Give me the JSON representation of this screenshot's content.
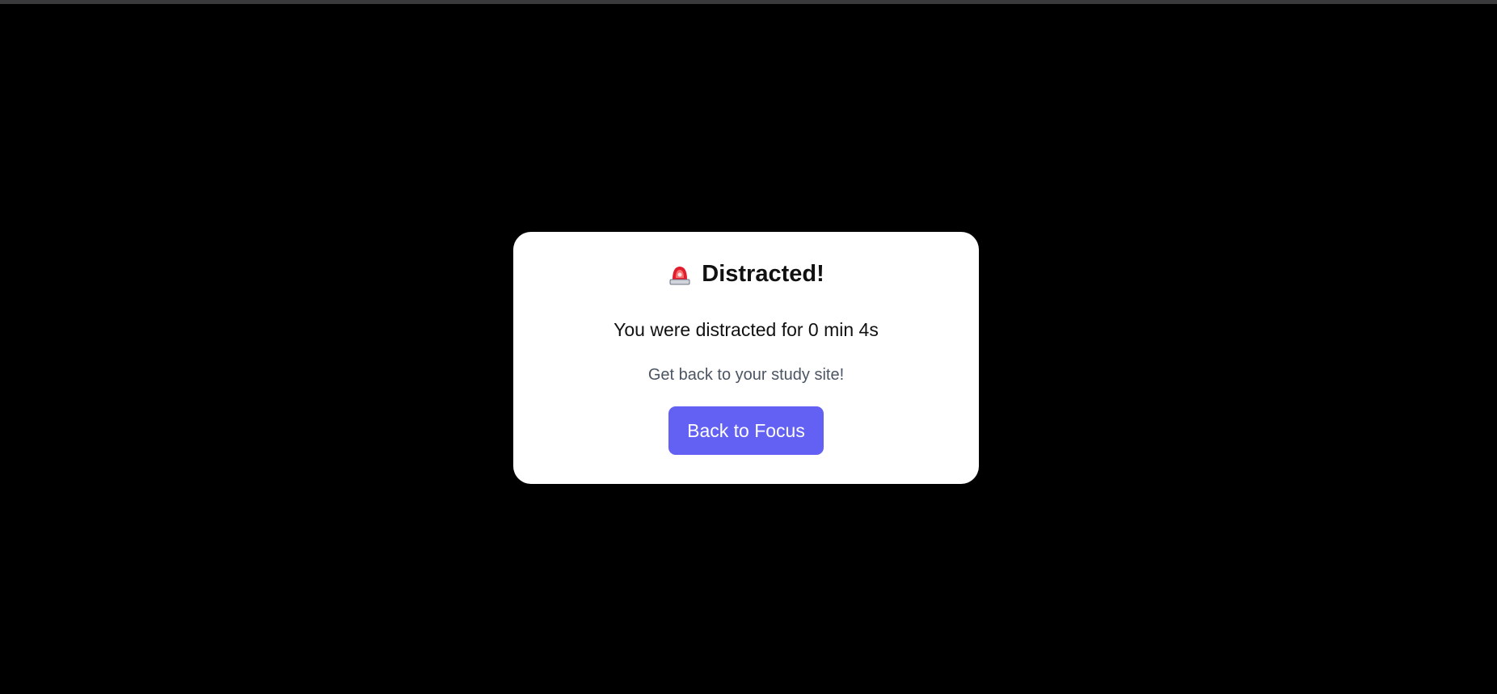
{
  "modal": {
    "icon": "siren-icon",
    "title": "Distracted!",
    "message": "You were distracted for 0 min 4s",
    "hint": "Get back to your study site!",
    "button_label": "Back to Focus"
  },
  "colors": {
    "background": "#000000",
    "card": "#ffffff",
    "button": "#6361f3",
    "button_text": "#ffffff",
    "hint_text": "#4b5563",
    "siren": "#e11d2e"
  }
}
